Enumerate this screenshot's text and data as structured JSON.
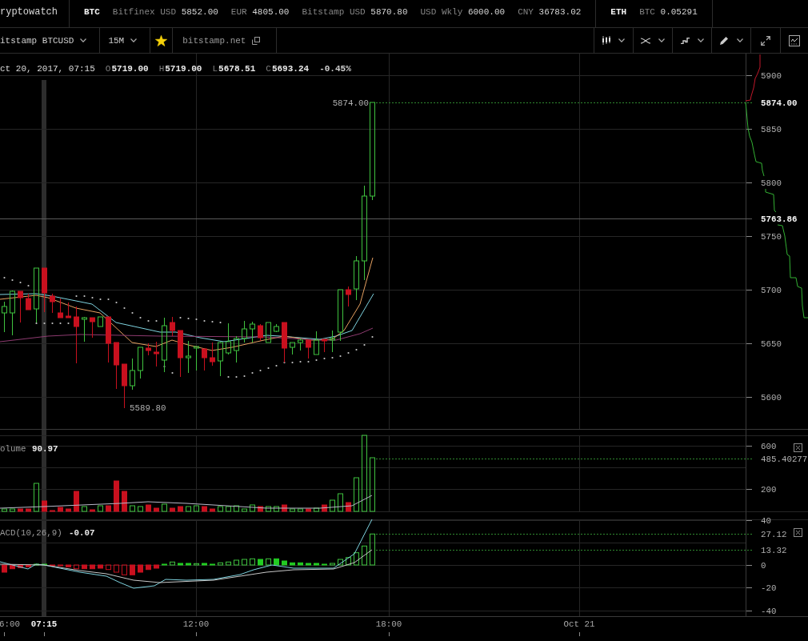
{
  "ticker_bar": {
    "brand": "ryptowatch",
    "groups": [
      {
        "symbol": "BTC",
        "quotes": [
          {
            "label": "Bitfinex USD",
            "value": "5852.00"
          },
          {
            "label": "EUR",
            "value": "4805.00"
          },
          {
            "label": "Bitstamp USD",
            "value": "5870.80"
          },
          {
            "label": "USD Wkly",
            "value": "6000.00"
          },
          {
            "label": "CNY",
            "value": "36783.02"
          }
        ]
      },
      {
        "symbol": "ETH",
        "quotes": [
          {
            "label": "BTC",
            "value": "0.05291"
          }
        ]
      }
    ]
  },
  "toolbar": {
    "market": "itstamp BTCUSD",
    "interval": "15M",
    "favorite": true,
    "exchange": "bitstamp.net"
  },
  "legend": {
    "time": "ct 20, 2017, 07:15",
    "ohlc": [
      {
        "label": "O",
        "value": "5719.00"
      },
      {
        "label": "H",
        "value": "5719.00"
      },
      {
        "label": "L",
        "value": "5678.51"
      },
      {
        "label": "C",
        "value": "5693.24"
      }
    ],
    "change": "-0.45%"
  },
  "price_chart": {
    "high_label": "5874.00",
    "low_label": "5589.80",
    "axis": [
      {
        "label": "5900",
        "kind": "tick"
      },
      {
        "label": "5874.00",
        "kind": "last-price"
      },
      {
        "label": "5850",
        "kind": "tick"
      },
      {
        "label": "5800",
        "kind": "tick"
      },
      {
        "label": "5763.86",
        "kind": "crosshair"
      },
      {
        "label": "5750",
        "kind": "tick"
      },
      {
        "label": "5700",
        "kind": "tick"
      },
      {
        "label": "5650",
        "kind": "tick"
      },
      {
        "label": "5600",
        "kind": "tick"
      }
    ]
  },
  "volume_pane": {
    "title": "olume",
    "value": "90.97",
    "axis": [
      {
        "label": "600",
        "kind": "tick"
      },
      {
        "label": "485.40277",
        "kind": "marker"
      },
      {
        "label": "200",
        "kind": "tick"
      }
    ]
  },
  "macd_pane": {
    "title": "ACD(10,26,9)",
    "value": "-0.07",
    "axis": [
      {
        "label": "40",
        "kind": "tick"
      },
      {
        "label": "27.12",
        "kind": "marker"
      },
      {
        "label": "13.32",
        "kind": "marker"
      },
      {
        "label": "0",
        "kind": "tick"
      },
      {
        "label": "-20",
        "kind": "tick"
      },
      {
        "label": "-40",
        "kind": "tick"
      }
    ]
  },
  "time_axis": [
    {
      "label": "6:00",
      "highlighted": false
    },
    {
      "label": "07:15",
      "highlighted": true
    },
    {
      "label": "12:00",
      "highlighted": false
    },
    {
      "label": "18:00",
      "highlighted": false
    },
    {
      "label": "Oct 21",
      "highlighted": false
    }
  ]
}
